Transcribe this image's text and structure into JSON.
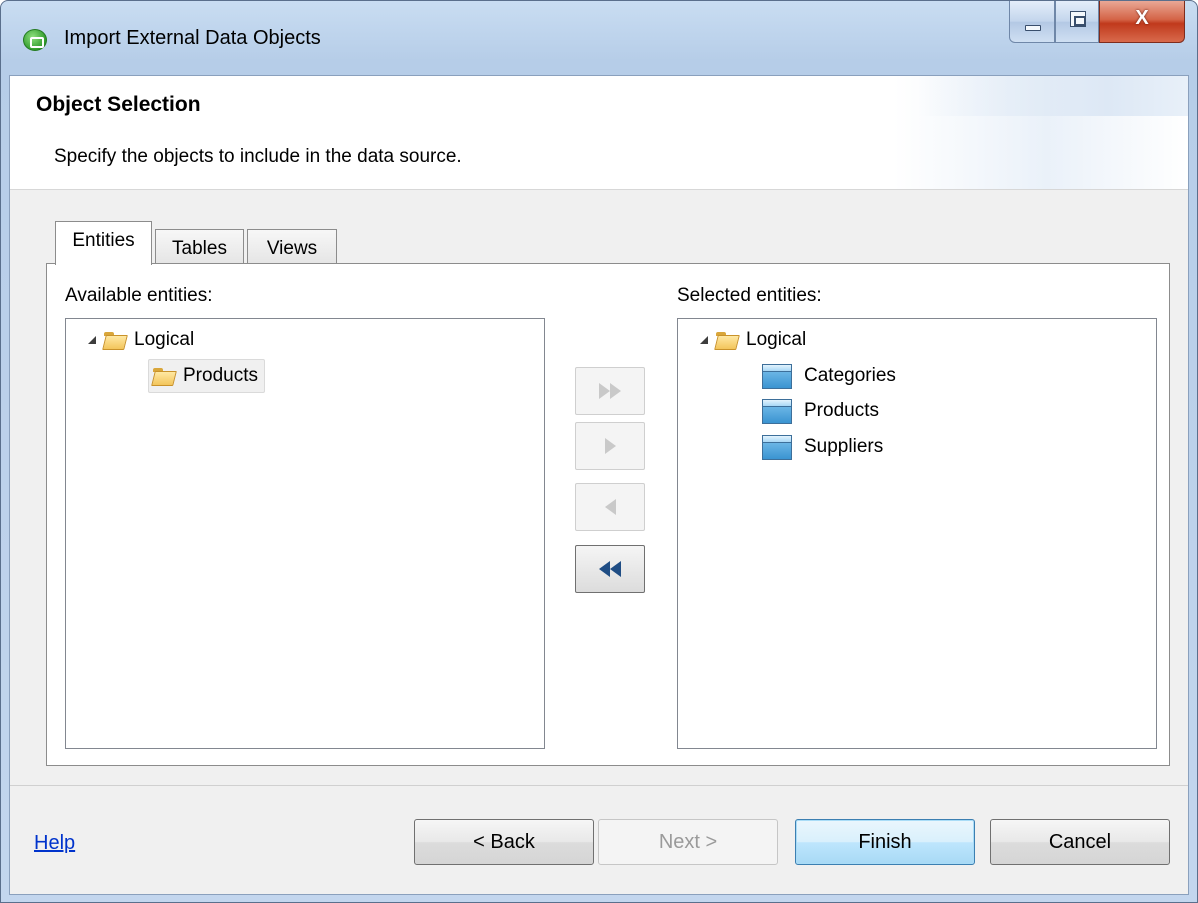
{
  "window": {
    "title": "Import External Data Objects",
    "close_glyph": "X"
  },
  "header": {
    "title": "Object Selection",
    "description": "Specify the objects to include in the data source."
  },
  "tabs": [
    {
      "label": "Entities",
      "active": true
    },
    {
      "label": "Tables",
      "active": false
    },
    {
      "label": "Views",
      "active": false
    }
  ],
  "available": {
    "label": "Available entities:",
    "tree": {
      "root": "Logical",
      "children": [
        "Products"
      ],
      "selected": "Products"
    }
  },
  "selected": {
    "label": "Selected entities:",
    "tree": {
      "root": "Logical",
      "children": [
        "Categories",
        "Products",
        "Suppliers"
      ]
    }
  },
  "transfer_buttons": [
    {
      "name": "add-all",
      "enabled": false
    },
    {
      "name": "add",
      "enabled": false
    },
    {
      "name": "remove",
      "enabled": false
    },
    {
      "name": "remove-all",
      "enabled": true
    }
  ],
  "footer": {
    "help": "Help",
    "back": "< Back",
    "next": "Next >",
    "finish": "Finish",
    "cancel": "Cancel"
  },
  "colors": {
    "title_bar": "#c9ddf2",
    "link": "#0033cc",
    "default_button": "#3c7fb1",
    "entity_icon": "#3a94d1"
  }
}
